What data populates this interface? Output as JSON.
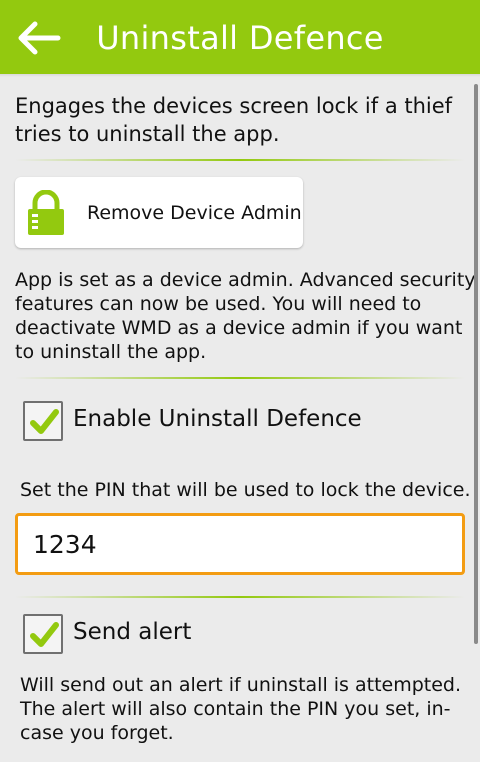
{
  "header": {
    "title": "Uninstall Defence",
    "back_icon": "back-arrow-icon",
    "accent": "#93c90f"
  },
  "intro": {
    "line1": "Engages the devices screen lock if a thief",
    "line2": "tries to uninstall the app."
  },
  "admin_button": {
    "label": "Remove Device Admin",
    "icon": "lock-icon"
  },
  "admin_info": {
    "lines": [
      "App is set as a device admin. Advanced security",
      "features can now be used. You will need to",
      "deactivate WMD as a device admin if you want",
      "to uninstall the app."
    ]
  },
  "uninstall_defence": {
    "label": "Enable Uninstall Defence",
    "checked": true
  },
  "pin": {
    "prompt": "Set the PIN that will be used to lock the device.",
    "value": "1234",
    "focus_color": "#f39c12"
  },
  "send_alert": {
    "label": "Send alert",
    "checked": true,
    "lines": [
      "Will send out an alert if uninstall is attempted.",
      "The alert will also contain the PIN you set, in-",
      "case you forget."
    ]
  }
}
